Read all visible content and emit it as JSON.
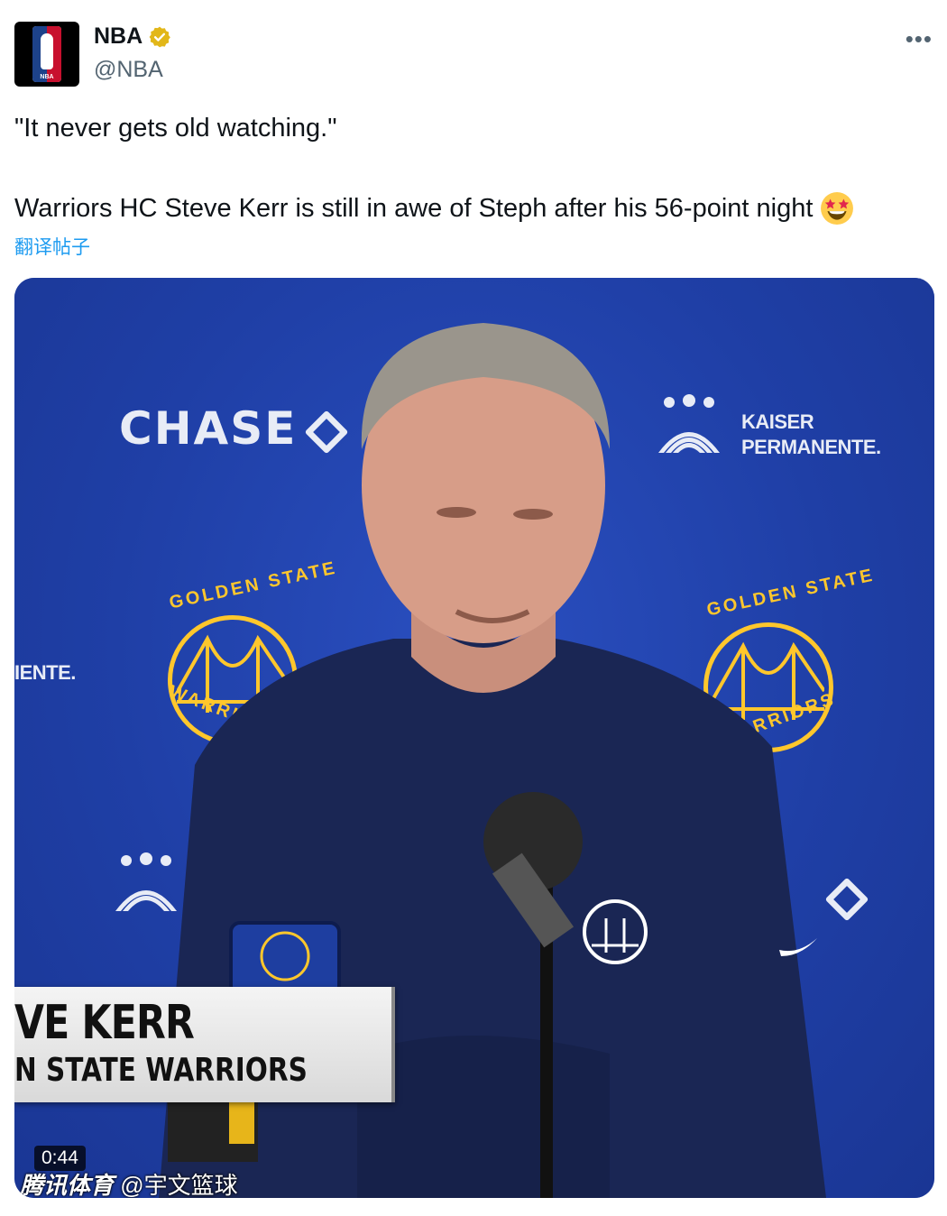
{
  "account": {
    "display_name": "NBA",
    "handle": "@NBA",
    "verified_icon": "verified-badge-icon",
    "avatar_icon": "nba-logo-icon",
    "avatar_logo_text": "NBA"
  },
  "tweet": {
    "line1": "\"It never gets old watching.\"",
    "line2": "Warriors HC Steve Kerr is still in awe of Steph after his 56-point night",
    "emoji": "star-struck-emoji",
    "translate_label": "翻译帖子",
    "more_label": "•••"
  },
  "media": {
    "sponsor_left": "CHASE",
    "sponsor_right_line1": "KAISER",
    "sponsor_right_line2": "PERMANENTE.",
    "sponsor_partial": "IENTE.",
    "gsw_top": "GOLDEN STATE",
    "gsw_bottom": "WARRIORS",
    "lower_third_name": "VE KERR",
    "lower_third_team": "N STATE WARRIORS",
    "duration": "0:44",
    "watermark_brand": "腾讯体育",
    "watermark_user": "@宇文篮球"
  },
  "colors": {
    "link": "#1d9bf0",
    "backdrop": "#1f3fa6",
    "warriors_gold": "#ffc72c",
    "verified_gold": "#e2b719"
  }
}
